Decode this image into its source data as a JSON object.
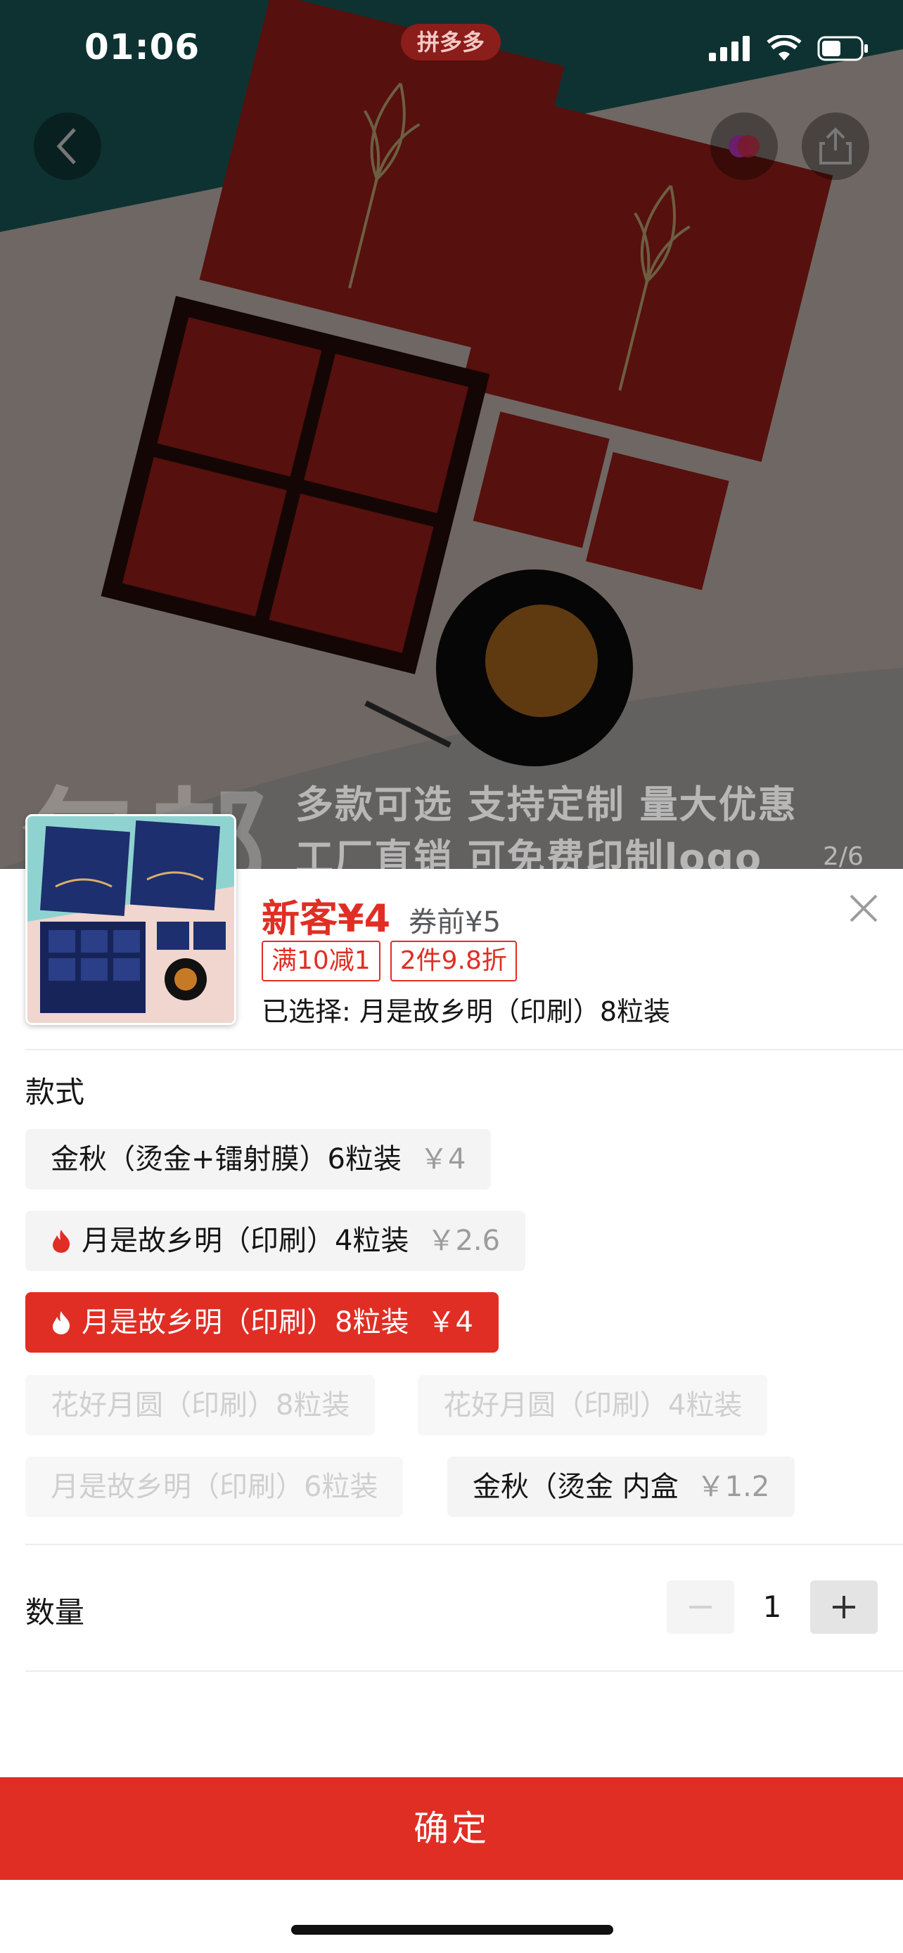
{
  "status_bar": {
    "time": "01:06",
    "app_badge": "拼多多"
  },
  "hero": {
    "banner_big": "包邮",
    "banner_line1": "多款可选 支持定制 量大优惠",
    "banner_line2": "工厂直销 可免费印制logo",
    "image_counter": "2/6"
  },
  "product": {
    "price_label": "新客¥4",
    "price_before_coupon": "券前¥5",
    "coupons": [
      "满10减1",
      "2件9.8折"
    ],
    "selected": "已选择: 月是故乡明（印刷）8粒装"
  },
  "style_section": {
    "title": "款式",
    "options": [
      {
        "label": "金秋（烫金+镭射膜）6粒装",
        "price": "￥4",
        "state": "normal",
        "hot": false
      },
      {
        "label": "月是故乡明（印刷）4粒装",
        "price": "￥2.6",
        "state": "normal",
        "hot": true
      },
      {
        "label": "月是故乡明（印刷）8粒装",
        "price": "￥4",
        "state": "selected",
        "hot": true
      },
      {
        "label": "花好月圆（印刷）8粒装",
        "price": "",
        "state": "disabled",
        "hot": false
      },
      {
        "label": "花好月圆（印刷）4粒装",
        "price": "",
        "state": "disabled",
        "hot": false
      },
      {
        "label": "月是故乡明（印刷）6粒装",
        "price": "",
        "state": "disabled",
        "hot": false
      },
      {
        "label": "金秋（烫金 内盒",
        "price": "￥1.2",
        "state": "normal",
        "hot": false
      }
    ]
  },
  "quantity": {
    "label": "数量",
    "value": "1"
  },
  "confirm_label": "确定",
  "colors": {
    "accent": "#e02e24",
    "option_bg": "#f4f4f4"
  }
}
